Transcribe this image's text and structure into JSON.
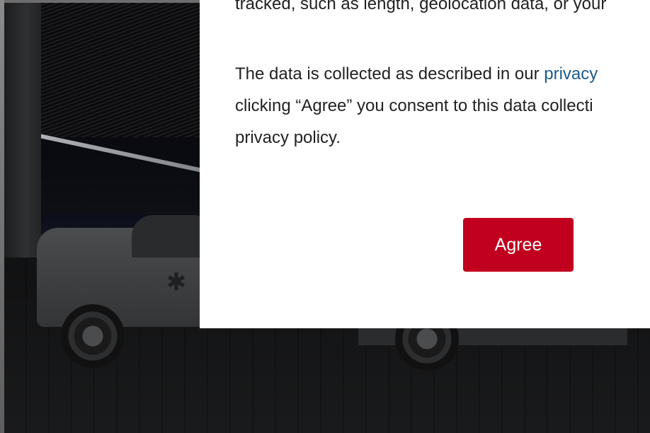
{
  "modal": {
    "top_text": "tracked, such as length, geolocation data, or your",
    "paragraph_before_link": "The data is collected as described in our ",
    "link_text": "privacy",
    "paragraph_line2": "clicking “Agree” you consent to this data collecti",
    "paragraph_line3": "privacy policy.",
    "agree_label": "Agree"
  },
  "colors": {
    "agree_button": "#c1001f",
    "link": "#1d5a8c",
    "text": "#222222"
  },
  "icons": {
    "truck_emblem": "star-of-life-icon"
  }
}
